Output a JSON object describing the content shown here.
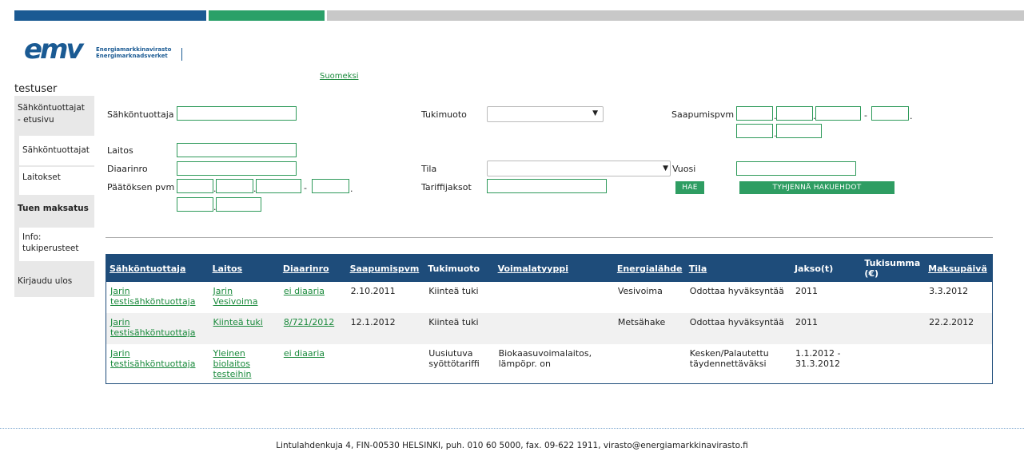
{
  "brand": {
    "logo_text": "emv",
    "line1": "Energiamarkkinavirasto",
    "line2": "Energimarknadsverket",
    "colors": {
      "blue": "#1a5a93",
      "green": "#2aa068",
      "gray": "#c8c8c8"
    }
  },
  "user": "testuser",
  "language_link": "Suomeksi",
  "sidebar": {
    "items": [
      {
        "label": "Sähköntuottajat - etusivu",
        "bold": false
      },
      {
        "label": "Sähköntuottajat",
        "bold": false
      },
      {
        "label": "Laitokset",
        "bold": false
      },
      {
        "label": "Tuen maksatus",
        "bold": true
      },
      {
        "label": "Info: tukiperusteet",
        "bold": false
      },
      {
        "label": "Kirjaudu ulos",
        "bold": false
      }
    ]
  },
  "form": {
    "sahkontuottaja": "Sähköntuottaja",
    "tukimuoto": "Tukimuoto",
    "saapumispvm": "Saapumispvm",
    "laitos": "Laitos",
    "diaarinro": "Diaarinro",
    "tila": "Tila",
    "vuosi": "Vuosi",
    "paatoksen_pvm": "Päätöksen pvm",
    "tariffijaksot": "Tariffijaksot",
    "dash": "-",
    "dot": ".",
    "search_button": "HAE",
    "clear_button": "TYHJENNÄ HAKUEHDOT"
  },
  "table": {
    "headers": [
      "Sähköntuottaja",
      "Laitos",
      "Diaarinro",
      "Saapumispvm",
      "Tukimuoto",
      "Voimalatyyppi",
      "Energialähde",
      "Tila",
      "Jakso(t)",
      "Tukisumma (€)",
      "Maksupäivä"
    ],
    "rows": [
      [
        "Jarin testisähköntuottaja",
        "Jarin Vesivoima",
        "ei diaaria",
        "2.10.2011",
        "Kiinteä tuki",
        "",
        "Vesivoima",
        "Odottaa hyväksyntää",
        "2011",
        "",
        "3.3.2012"
      ],
      [
        "Jarin testisähköntuottaja",
        "Kiinteä tuki",
        "8/721/2012",
        "12.1.2012",
        "Kiinteä tuki",
        "",
        "Metsähake",
        "Odottaa hyväksyntää",
        "2011",
        "",
        "22.2.2012"
      ],
      [
        "Jarin testisähköntuottaja",
        "Yleinen biolaitos testeihin",
        "ei diaaria",
        "",
        "Uusiutuva syöttötariffi",
        "Biokaasuvoimalaitos, lämpöpr. on",
        "",
        "Kesken/Palautettu täydennettäväksi",
        "1.1.2012 - 31.3.2012",
        "",
        ""
      ]
    ]
  },
  "footer": "Lintulahdenkuja 4, FIN-00530 HELSINKI, puh. 010 60 5000, fax. 09-622 1911, virasto@energiamarkkinavirasto.fi"
}
